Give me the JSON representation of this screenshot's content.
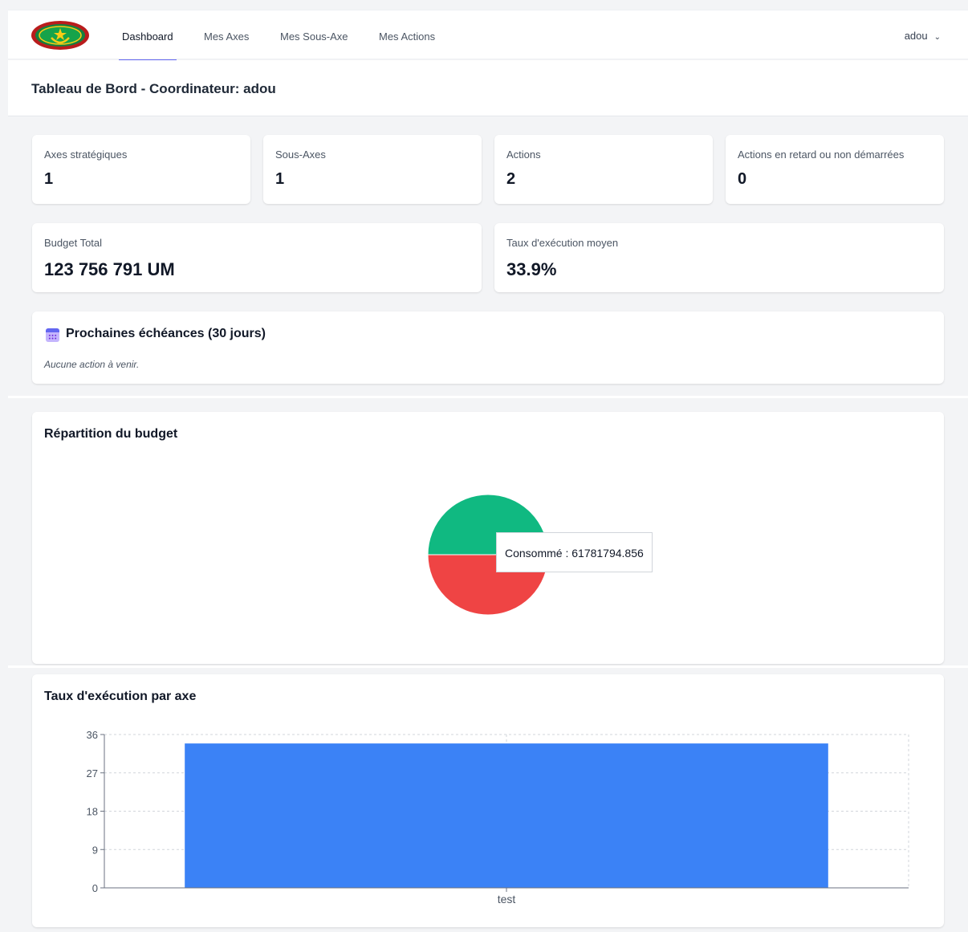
{
  "nav": {
    "items": [
      {
        "label": "Dashboard",
        "active": true
      },
      {
        "label": "Mes Axes",
        "active": false
      },
      {
        "label": "Mes Sous-Axe",
        "active": false
      },
      {
        "label": "Mes Actions",
        "active": false
      }
    ],
    "user": "adou",
    "user_icon": "chevron-down-icon",
    "logo_icon": "emblem-logo-icon"
  },
  "header": {
    "title": "Tableau de Bord - Coordinateur: adou"
  },
  "stats": [
    {
      "label": "Axes stratégiques",
      "value": "1"
    },
    {
      "label": "Sous-Axes",
      "value": "1"
    },
    {
      "label": "Actions",
      "value": "2"
    },
    {
      "label": "Actions en retard ou non démarrées",
      "value": "0"
    }
  ],
  "budget": {
    "label": "Budget Total",
    "value": "123 756 791 UM"
  },
  "execution": {
    "label": "Taux d'exécution moyen",
    "value": "33.9%"
  },
  "deadlines": {
    "title": "Prochaines échéances (30 jours)",
    "icon": "calendar-icon",
    "empty": "Aucune action à venir."
  },
  "pie_section": {
    "title": "Répartition du budget"
  },
  "bar_section": {
    "title": "Taux d'exécution par axe"
  },
  "colors": {
    "consumed": "#10b981",
    "remaining": "#ef4444",
    "bar": "#3b82f6",
    "accent": "#6366f1"
  },
  "chart_data": [
    {
      "type": "pie",
      "slices": [
        {
          "name": "Consommé",
          "value": 61781794.856,
          "color": "#10b981"
        },
        {
          "name": "",
          "value": 61974996.144,
          "color": "#ef4444"
        }
      ],
      "tooltip": "Consommé : 61781794.856"
    },
    {
      "type": "bar",
      "categories": [
        "test"
      ],
      "values": [
        33.9
      ],
      "ylim": [
        0,
        36
      ],
      "yticks": [
        0,
        9,
        18,
        27,
        36
      ],
      "grid": true
    }
  ]
}
